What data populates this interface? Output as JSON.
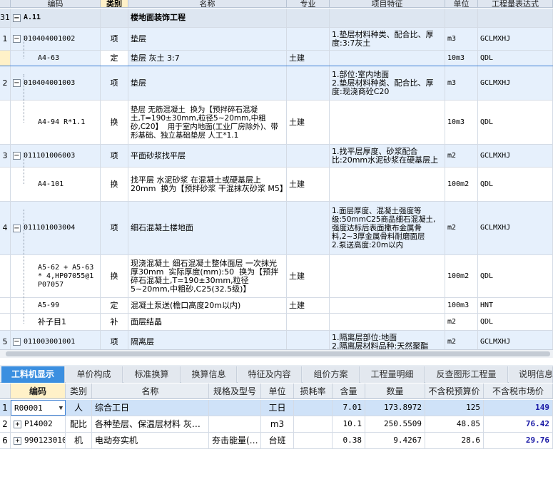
{
  "columns": {
    "code": "编码",
    "type": "类别",
    "name": "名称",
    "major": "专业",
    "feature": "项目特征",
    "unit": "单位",
    "expr": "工程量表达式"
  },
  "rows": [
    {
      "idx": "31",
      "code": "A.11",
      "type": "",
      "name": "楼地面装饰工程",
      "major": "",
      "feature": "",
      "unit": "",
      "expr": ""
    },
    {
      "idx": "1",
      "code": "010404001002",
      "type": "项",
      "name": "垫层",
      "major": "",
      "feature": "1.垫层材料种类、配合比、厚度:3:7灰土",
      "unit": "m3",
      "expr": "GCLMXHJ"
    },
    {
      "idx": "",
      "code": "A4-63",
      "type": "定",
      "name": "垫层 灰土 3:7",
      "major": "土建",
      "feature": "",
      "unit": "10m3",
      "expr": "QDL"
    },
    {
      "idx": "2",
      "code": "010404001003",
      "type": "项",
      "name": "垫层",
      "major": "",
      "feature": "1.部位:室内地面\n2.垫层材料种类、配合比、厚度:现浇商砼C20",
      "unit": "m3",
      "expr": "GCLMXHJ"
    },
    {
      "idx": "",
      "code": "A4-94 R*1.1",
      "type": "换",
      "name": "垫层 无筋混凝土  换为【预拌碎石混凝土,T=190±30mm,粒径5~20mm,中粗砂,C20】  用于室内地面(工业厂房除外)、带形基础、独立基础垫层 人工*1.1",
      "major": "土建",
      "feature": "",
      "unit": "10m3",
      "expr": "QDL"
    },
    {
      "idx": "3",
      "code": "011101006003",
      "type": "项",
      "name": "平面砂浆找平层",
      "major": "",
      "feature": "1.找平层厚度、砂浆配合比:20mm水泥砂浆在硬基层上",
      "unit": "m2",
      "expr": "GCLMXHJ"
    },
    {
      "idx": "",
      "code": "A4-101",
      "type": "换",
      "name": "找平层 水泥砂浆 在混凝土或硬基层上 20mm  换为【预拌砂浆 干混抹灰砂浆 M5】",
      "major": "土建",
      "feature": "",
      "unit": "100m2",
      "expr": "QDL"
    },
    {
      "idx": "4",
      "code": "011101003004",
      "type": "项",
      "name": "细石混凝土楼地面",
      "major": "",
      "feature": "1.面层厚度、混凝土强度等级:50mmC25商品细石混凝土,强度达标后表面撒布金属骨料,2~3厚金属骨料耐磨面层\n2.泵送高度:20m以内",
      "unit": "m2",
      "expr": "GCLMXHJ"
    },
    {
      "idx": "",
      "code": "A5-62 + A5-63\n* 4,HP07055@1\nP07057",
      "type": "换",
      "name": "现浇混凝土 细石混凝土整体面层 一次抹光厚30mm  实际厚度(mm):50  换为【预拌碎石混凝土,T=190±30mm,粒径5~20mm,中粗砂,C25(32.5级)】",
      "major": "土建",
      "feature": "",
      "unit": "100m2",
      "expr": "QDL"
    },
    {
      "idx": "",
      "code": "A5-99",
      "type": "定",
      "name": "混凝土泵送(檐口高度20m以内)",
      "major": "土建",
      "feature": "",
      "unit": "100m3",
      "expr": "HNT"
    },
    {
      "idx": "",
      "code": "补子目1",
      "type": "补",
      "name": "面层结晶",
      "major": "",
      "feature": "",
      "unit": "m2",
      "expr": "QDL"
    },
    {
      "idx": "5",
      "code": "011003001001",
      "type": "项",
      "name": "隔离层",
      "major": "",
      "feature": "1.隔离层部位:地面\n2.隔离层材料品种:天然聚酯",
      "unit": "m2",
      "expr": "GCLMXHJ"
    }
  ],
  "tabs": [
    "工料机显示",
    "单价构成",
    "标准换算",
    "换算信息",
    "特征及内容",
    "组价方案",
    "工程量明细",
    "反查图形工程量",
    "说明信息"
  ],
  "bottom_columns": {
    "code": "编码",
    "type": "类别",
    "name": "名称",
    "spec": "规格及型号",
    "unit": "单位",
    "loss": "损耗率",
    "qty": "含量",
    "amount": "数量",
    "tax_price": "不含税预算价",
    "market_price": "不含税市场价"
  },
  "bottom_rows": [
    {
      "idx": "1",
      "code": "R00001",
      "type": "人",
      "name": "综合工日",
      "spec": "",
      "unit": "工日",
      "loss": "",
      "qty": "7.01",
      "amount": "173.8972",
      "tax_price": "125",
      "market_price": "149"
    },
    {
      "idx": "2",
      "code": "P14002",
      "type": "配比",
      "name": "各种垫层、保温层材料 灰…",
      "spec": "",
      "unit": "m3",
      "loss": "",
      "qty": "10.1",
      "amount": "250.5509",
      "tax_price": "48.85",
      "market_price": "76.42"
    },
    {
      "idx": "6",
      "code": "990123010",
      "type": "机",
      "name": "电动夯实机",
      "spec": "夯击能量(…",
      "unit": "台班",
      "loss": "",
      "qty": "0.38",
      "amount": "9.4267",
      "tax_price": "28.6",
      "market_price": "29.76"
    }
  ]
}
